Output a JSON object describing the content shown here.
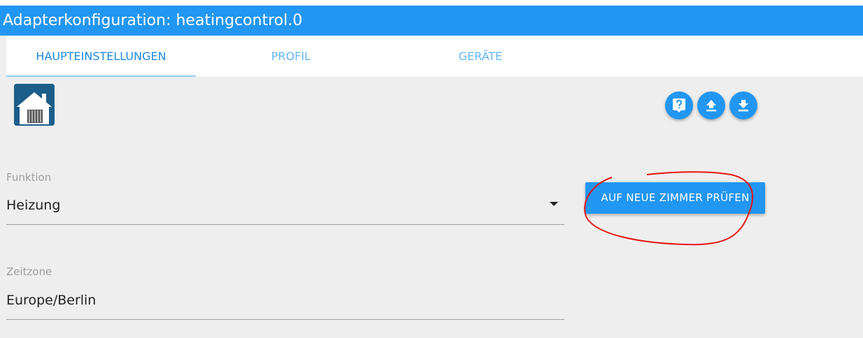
{
  "window": {
    "title": "Adapterkonfiguration: heatingcontrol.0"
  },
  "tabs": [
    {
      "label": "HAUPTEINSTELLUNGEN",
      "active": true
    },
    {
      "label": "PROFIL",
      "active": false
    },
    {
      "label": "GERÄTE",
      "active": false
    }
  ],
  "logo": {
    "icon": "house-radiator-icon"
  },
  "toolbar": {
    "buttons": [
      {
        "icon": "help-icon"
      },
      {
        "icon": "upload-icon"
      },
      {
        "icon": "download-icon"
      }
    ]
  },
  "form": {
    "function": {
      "label": "Funktion",
      "value": "Heizung"
    },
    "timezone": {
      "label": "Zeitzone",
      "value": "Europe/Berlin"
    }
  },
  "actions": {
    "check_rooms_label": "AUF NEUE ZIMMER PRÜFEN"
  },
  "colors": {
    "primary": "#2196f3",
    "background": "#eeeeee",
    "annotation": "#e81414"
  }
}
